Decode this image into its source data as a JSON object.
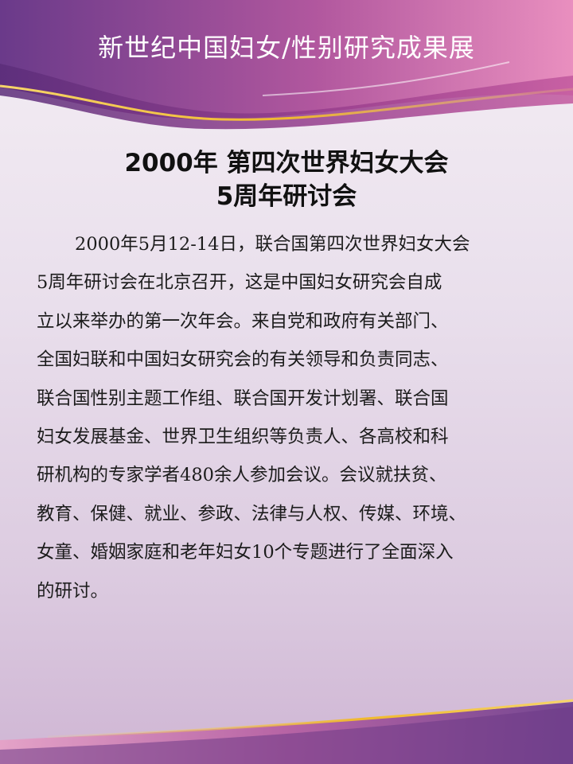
{
  "banner": {
    "title": "新世纪中国妇女/性别研究成果展"
  },
  "slide": {
    "heading_line1": "2000年 第四次世界妇女大会",
    "heading_line2": "5周年研讨会",
    "body_lines": [
      "2000年5月12-14日，联合国第四次世界妇女大会",
      "5周年研讨会在北京召开，这是中国妇女研究会自成",
      "立以来举办的第一次年会。来自党和政府有关部门、",
      "全国妇联和中国妇女研究会的有关领导和负责同志、",
      "联合国性别主题工作组、联合国开发计划署、联合国",
      "妇女发展基金、世界卫生组织等负责人、各高校和科",
      "研机构的专家学者480余人参加会议。会议就扶贫、",
      "教育、保健、就业、参政、法律与人权、传媒、环境、",
      "女童、婚姻家庭和老年妇女10个专题进行了全面深入",
      "的研讨。"
    ]
  },
  "colors": {
    "banner_purple": "#7a3d8c",
    "banner_pink": "#e27bb0",
    "accent_gold": "#f0c23a",
    "background": "#ece3ee"
  }
}
